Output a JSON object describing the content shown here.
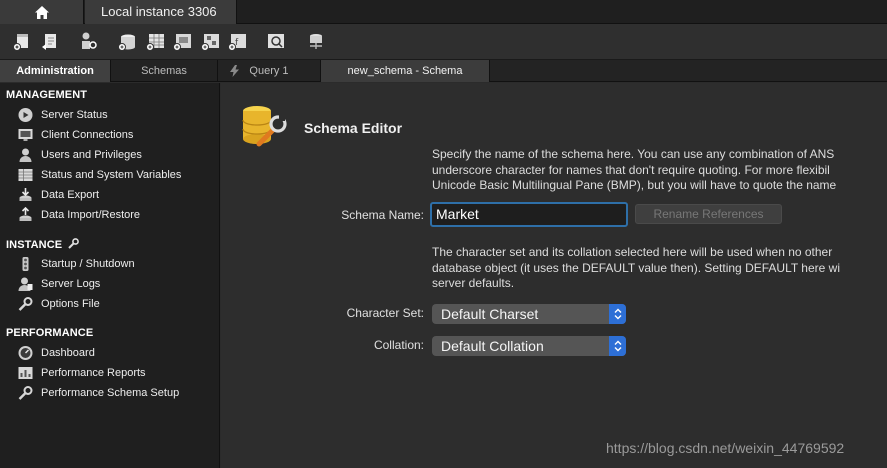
{
  "top_tabs": {
    "home_icon": "home-icon",
    "connection": "Local instance 3306"
  },
  "toolbar": {
    "icons": [
      "new-query-icon",
      "open-sql-script-icon",
      "inspector-icon",
      "create-schema-icon",
      "create-table-icon",
      "create-view-icon",
      "create-procedure-icon",
      "create-function-icon",
      "search-table-data-icon",
      "reconnect-icon"
    ]
  },
  "tabs": {
    "administration": "Administration",
    "schemas": "Schemas",
    "query1": "Query 1",
    "schema_tab": "new_schema - Schema"
  },
  "sidebar": {
    "management": {
      "heading": "MANAGEMENT",
      "items": [
        {
          "label": "Server Status",
          "icon": "play-icon"
        },
        {
          "label": "Client Connections",
          "icon": "monitor-icon"
        },
        {
          "label": "Users and Privileges",
          "icon": "user-icon"
        },
        {
          "label": "Status and System Variables",
          "icon": "table-icon"
        },
        {
          "label": "Data Export",
          "icon": "export-icon"
        },
        {
          "label": "Data Import/Restore",
          "icon": "import-icon"
        }
      ]
    },
    "instance": {
      "heading": "INSTANCE",
      "heading_icon": "wrench-icon",
      "items": [
        {
          "label": "Startup / Shutdown",
          "icon": "traffic-light-icon"
        },
        {
          "label": "Server Logs",
          "icon": "log-icon"
        },
        {
          "label": "Options File",
          "icon": "wrench-icon"
        }
      ]
    },
    "performance": {
      "heading": "PERFORMANCE",
      "items": [
        {
          "label": "Dashboard",
          "icon": "dashboard-icon"
        },
        {
          "label": "Performance Reports",
          "icon": "reports-icon"
        },
        {
          "label": "Performance Schema Setup",
          "icon": "schema-setup-icon"
        }
      ]
    }
  },
  "editor": {
    "title": "Schema Editor",
    "title_icon": "database-wrench-icon",
    "desc1": [
      "Specify the name of the schema here. You can use any combination of ANS",
      "underscore character for names that don't require quoting. For more flexibil",
      "Unicode Basic Multilingual Pane (BMP), but you will have to quote the name"
    ],
    "schema_name_label": "Schema Name:",
    "schema_name_value": "Market",
    "rename_button": "Rename References",
    "desc2": [
      "The character set and its collation selected here will be used when no other",
      "database object (it uses the DEFAULT value then). Setting DEFAULT here wi",
      "server defaults."
    ],
    "charset_label": "Character Set:",
    "charset_value": "Default Charset",
    "collation_label": "Collation:",
    "collation_value": "Default Collation"
  },
  "watermark": "https://blog.csdn.net/weixin_44769592",
  "colors": {
    "accent": "#2d6fd6",
    "focus": "#2e6fa8"
  }
}
